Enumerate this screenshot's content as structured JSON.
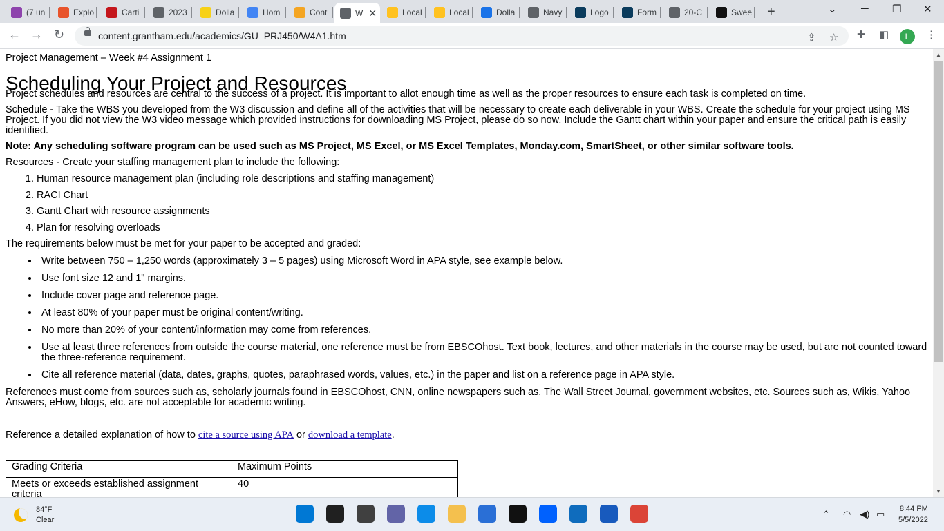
{
  "browser": {
    "tabs": [
      {
        "label": "(7 un",
        "icon": "gmail-icon",
        "color": "#8e44ad"
      },
      {
        "label": "Explo",
        "icon": "c-logo-icon",
        "color": "#e8542c"
      },
      {
        "label": "Carti",
        "icon": "cartier-icon",
        "color": "#c4161c"
      },
      {
        "label": "2023",
        "icon": "globe-icon",
        "color": "#5f6368"
      },
      {
        "label": "Dolla",
        "icon": "dollar-general-icon",
        "color": "#f7d117"
      },
      {
        "label": "Hom",
        "icon": "google-sites-icon",
        "color": "#4285f4"
      },
      {
        "label": "Cont",
        "icon": "edit-icon",
        "color": "#f4a522"
      },
      {
        "label": "W",
        "icon": "globe-icon",
        "color": "#5f6368",
        "active": true
      },
      {
        "label": "Local",
        "icon": "walmart-spark-icon",
        "color": "#ffc220"
      },
      {
        "label": "Local",
        "icon": "walmart-spark-icon",
        "color": "#ffc220"
      },
      {
        "label": "Dolla",
        "icon": "hand-icon",
        "color": "#1a73e8"
      },
      {
        "label": "Navy",
        "icon": "globe-icon",
        "color": "#5f6368"
      },
      {
        "label": "Logo",
        "icon": "pentagon-icon",
        "color": "#0b3c5d"
      },
      {
        "label": "Form",
        "icon": "pentagon-icon",
        "color": "#0b3c5d"
      },
      {
        "label": "20-C",
        "icon": "globe-icon",
        "color": "#5f6368"
      },
      {
        "label": "Swee",
        "icon": "sweepstakes-icon",
        "color": "#111111"
      }
    ],
    "url": "content.grantham.edu/academics/GU_PRJ450/W4A1.htm",
    "profile_initial": "L",
    "profile_color": "#34a853"
  },
  "page": {
    "course": "Project Management – Week #4 Assignment 1",
    "title": "Scheduling Your Project and Resources",
    "intro": "Project schedules and resources are central to the success of a project. It is important to allot enough time as well as the proper resources to ensure each task is completed on time.",
    "schedule": "Schedule - Take the WBS you developed from the W3 discussion and define all of the activities that will be necessary to create each deliverable in your WBS. Create the schedule for your project using MS Project. If you did not view the W3 video message which provided instructions for downloading MS Project, please do so now. Include the Gantt chart within your paper and ensure the critical path is easily identified.",
    "note": "Note: Any scheduling software program can be used such as MS Project, MS Excel, or MS Excel Templates, Monday.com, SmartSheet, or other similar software tools.",
    "resources_intro": "Resources - Create your staffing management plan to include the following:",
    "resources": [
      "Human resource management plan (including role descriptions and staffing management)",
      "RACI Chart",
      "Gantt Chart with resource assignments",
      "Plan for resolving overloads"
    ],
    "requirements_intro": "The requirements below must be met for your paper to be accepted and graded:",
    "requirements": [
      "Write between 750 – 1,250 words (approximately 3 – 5 pages) using Microsoft Word in APA style, see example below.",
      "Use font size 12 and 1\" margins.",
      "Include cover page and reference page.",
      "At least 80% of your paper must be original content/writing.",
      "No more than 20% of your content/information may come from references.",
      "Use at least three references from outside the course material, one reference must be from EBSCOhost. Text book, lectures, and other materials in the course may be used, but are not counted toward the three-reference requirement.",
      "Cite all reference material (data, dates, graphs, quotes, paraphrased words, values, etc.) in the paper and list on a reference page in APA style."
    ],
    "references_note": "References must come from sources such as, scholarly journals found in EBSCOhost, CNN, online newspapers such as, The Wall Street Journal, government websites, etc. Sources such as, Wikis, Yahoo Answers, eHow, blogs, etc. are not acceptable for academic writing.",
    "reference_prefix": "Reference a detailed explanation of how to ",
    "link_apa": "cite a source using APA",
    "reference_or": " or ",
    "link_template": "download a template",
    "reference_suffix": ".",
    "grading_headers": [
      "Grading Criteria",
      "Maximum Points"
    ],
    "grading_rows": [
      [
        "Meets or exceeds established assignment criteria",
        "40"
      ]
    ]
  },
  "taskbar": {
    "temperature": "84°F",
    "condition": "Clear",
    "time": "8:44 PM",
    "date": "5/5/2022",
    "apps": [
      {
        "name": "start-icon",
        "color": "#0078d4"
      },
      {
        "name": "search-icon",
        "color": "#202020"
      },
      {
        "name": "task-view-icon",
        "color": "#404040"
      },
      {
        "name": "chat-icon",
        "color": "#6264a7"
      },
      {
        "name": "edge-icon",
        "color": "#0c8ce9"
      },
      {
        "name": "file-explorer-icon",
        "color": "#f4c04e"
      },
      {
        "name": "store-icon",
        "color": "#2a6fd6"
      },
      {
        "name": "amazon-icon",
        "color": "#111111"
      },
      {
        "name": "dropbox-icon",
        "color": "#0061fe"
      },
      {
        "name": "mail-icon",
        "color": "#0f6cbd"
      },
      {
        "name": "word-icon",
        "color": "#185abd"
      },
      {
        "name": "chrome-icon",
        "color": "#db4437"
      }
    ]
  }
}
